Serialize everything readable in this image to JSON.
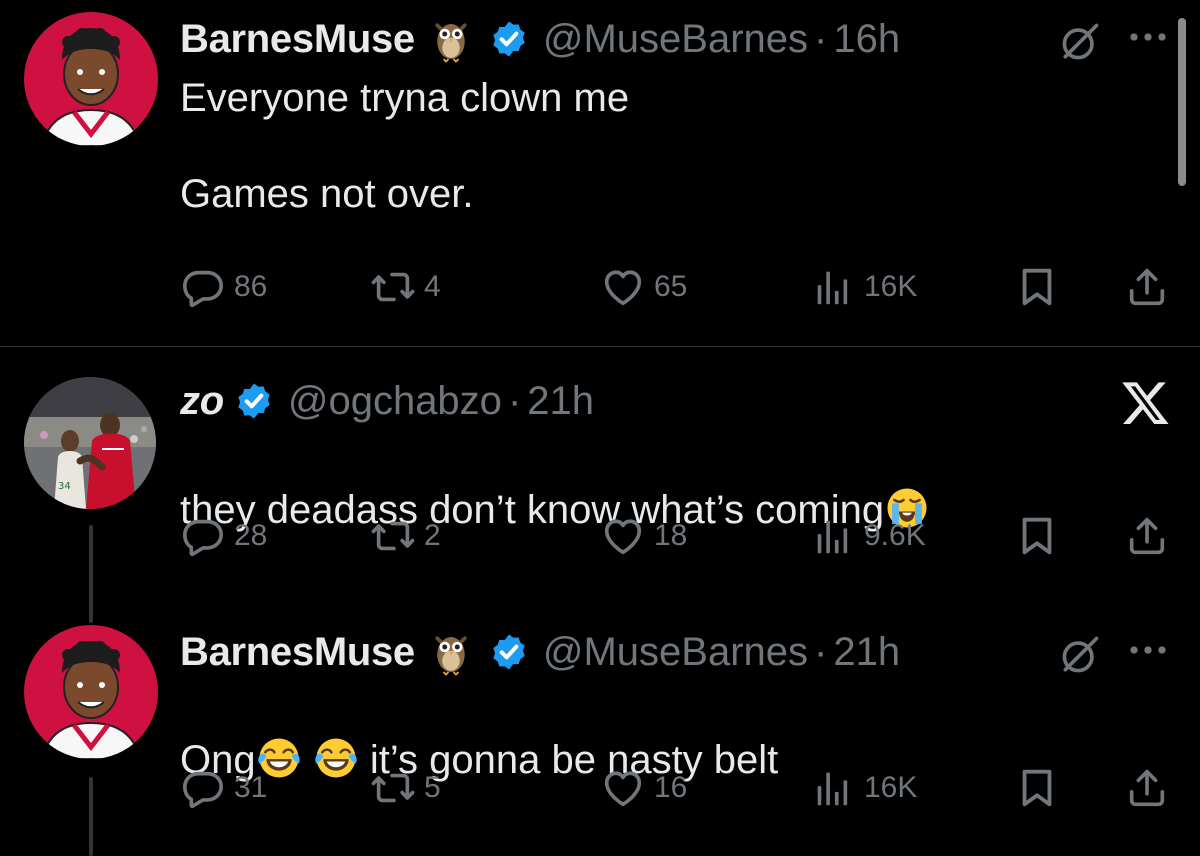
{
  "colors": {
    "background": "#000000",
    "text": "#e7e9ea",
    "muted": "#71767b",
    "verified": "#1d9bf0",
    "avatar_red": "#ce1141"
  },
  "tweets": [
    {
      "name": "BarnesMuse",
      "name_emoji": "owl",
      "verified": true,
      "handle": "@MuseBarnes",
      "dot": "·",
      "time": "16h",
      "text": "Everyone tryna clown me\n\nGames not over.",
      "text_emojis": [],
      "top_right_icons": [
        "grok-icon",
        "more-icon"
      ],
      "replies": "86",
      "reposts": "4",
      "likes": "65",
      "views": "16K"
    },
    {
      "name": "zo",
      "verified": true,
      "handle": "@ogchabzo",
      "dot": "·",
      "time": "21h",
      "text": "they deadass don’t know what’s coming",
      "text_emojis": [
        "loudly-crying-face"
      ],
      "top_right_icons": [
        "x-logo-icon"
      ],
      "replies": "28",
      "reposts": "2",
      "likes": "18",
      "views": "9.6K"
    },
    {
      "name": "BarnesMuse",
      "name_emoji": "owl",
      "verified": true,
      "handle": "@MuseBarnes",
      "dot": "·",
      "time": "21h",
      "text_prefix": "Ong",
      "text_suffix": " it’s gonna be nasty belt",
      "text_emojis": [
        "face-with-tears-of-joy",
        "face-with-tears-of-joy"
      ],
      "top_right_icons": [
        "grok-icon",
        "more-icon"
      ],
      "replies": "31",
      "reposts": "5",
      "likes": "16",
      "views": "16K"
    }
  ]
}
